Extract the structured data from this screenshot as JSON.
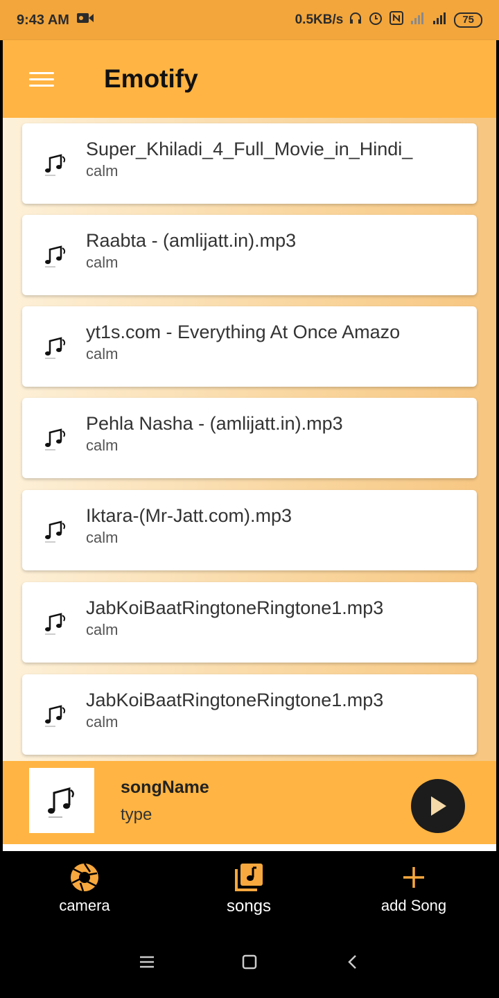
{
  "status_bar": {
    "time": "9:43 AM",
    "network_speed": "0.5KB/s",
    "battery": "75",
    "icons": [
      "video-record-icon",
      "headset-icon",
      "alarm-icon",
      "nfc-icon",
      "signal-icon",
      "signal-icon"
    ]
  },
  "app_bar": {
    "title": "Emotify",
    "menu_icon": "hamburger-menu-icon"
  },
  "songs": [
    {
      "title": "Super_Khiladi_4_Full_Movie_in_Hindi_",
      "type": "calm"
    },
    {
      "title": "Raabta - (amlijatt.in).mp3",
      "type": "calm"
    },
    {
      "title": "yt1s.com - Everything At Once  Amazo",
      "type": "calm"
    },
    {
      "title": "Pehla Nasha - (amlijatt.in).mp3",
      "type": "calm"
    },
    {
      "title": "Iktara-(Mr-Jatt.com).mp3",
      "type": "calm"
    },
    {
      "title": "JabKoiBaatRingtoneRingtone1.mp3",
      "type": "calm"
    },
    {
      "title": "JabKoiBaatRingtoneRingtone1.mp3",
      "type": "calm"
    }
  ],
  "player": {
    "song_name": "songName",
    "song_type": "type",
    "play_icon": "play-icon"
  },
  "bottom_nav": {
    "items": [
      {
        "label": "camera",
        "icon": "camera-aperture-icon"
      },
      {
        "label": "songs",
        "icon": "music-library-icon"
      },
      {
        "label": "add Song",
        "icon": "plus-icon"
      }
    ]
  },
  "colors": {
    "accent": "#ffb443",
    "status_bar": "#f2a63c",
    "nav_icon": "#f7a83e"
  }
}
